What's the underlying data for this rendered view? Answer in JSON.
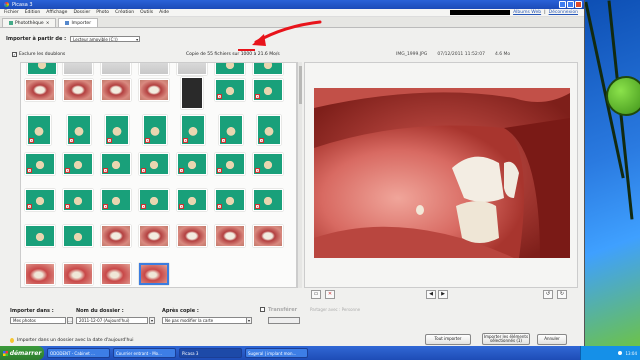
{
  "window": {
    "title": "Picasa 3"
  },
  "menu": [
    "Fichier",
    "Édition",
    "Affichage",
    "Dossier",
    "Photo",
    "Création",
    "Outils",
    "Aide"
  ],
  "menu_links": {
    "albums_web": "Albums Web",
    "logout": "Déconnexion"
  },
  "tabs": [
    {
      "label": "Photothèque"
    },
    {
      "label": "Importer"
    }
  ],
  "import_from": {
    "label": "Importer à partir de :",
    "source": "Lecteur amovible (C:\\)"
  },
  "exclude_duplicates": {
    "label": "Exclure les doublons",
    "checked": true
  },
  "copy_status": "Copie de 55 fichiers sur 1000 à 21.6 Mo/s",
  "file_info": {
    "name": "IMG_1999.JPG",
    "datetime": "07/12/2011 11:52:07",
    "size": "4.6 Mo"
  },
  "annotation_color": "#e8131a",
  "bottom": {
    "import_into_label": "Importer dans :",
    "import_into_value": "Mes photos",
    "folder_name_label": "Nom du dossier :",
    "folder_name_value": "2011-12-07 (Aujourd'hui)",
    "after_copy_label": "Après copie :",
    "after_copy_value": "Ne pas modifier la carte",
    "transfer_label": "Transférer",
    "share_label": "Partager avec : Personne",
    "status": "Importer dans un dossier avec la date d'aujourd'hui"
  },
  "buttons": {
    "import_all": "Tout importer",
    "import_selected": "Importer les éléments sélectionnés (1)",
    "cancel": "Annuler"
  },
  "taskbar": {
    "start": "démarrer",
    "tasks": [
      "ODODENT - Cabinet ...",
      "Courrier entrant - Mo...",
      "Picasa 3",
      "Sugeral | implant mon..."
    ],
    "clock": "13:04"
  },
  "icons": {
    "title": "picasa-icon",
    "selected_badge": "excluded-icon",
    "rotate_left": "rotate-left-icon",
    "rotate_right": "rotate-right-icon",
    "prev": "prev-icon",
    "next": "next-icon"
  }
}
